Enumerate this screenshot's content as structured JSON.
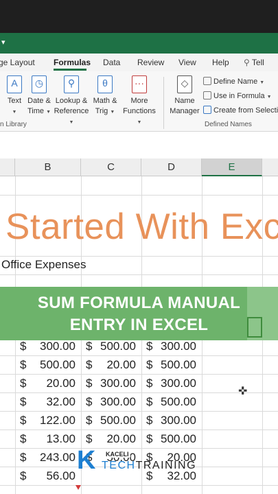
{
  "ribbon_tabs": [
    "ge Layout",
    "Formulas",
    "Data",
    "Review",
    "View",
    "Help",
    "Tell"
  ],
  "active_tab": "Formulas",
  "ribbon_buttons": {
    "text": [
      "Text"
    ],
    "datetime": [
      "Date &",
      "Time"
    ],
    "lookup": [
      "Lookup &",
      "Reference"
    ],
    "mathtrig": [
      "Math &",
      "Trig"
    ],
    "more": [
      "More",
      "Functions"
    ],
    "name_manager": [
      "Name",
      "Manager"
    ]
  },
  "groups": {
    "function_library": "n Library",
    "defined_names": "Defined Names"
  },
  "defined_names_items": [
    "Define Name",
    "Use in Formula",
    "Create from Selection"
  ],
  "columns": [
    "B",
    "C",
    "D",
    "E"
  ],
  "selected_column": "E",
  "banner_heading": "Started With Exc",
  "subheading": "Office Expenses",
  "overlay_lines": [
    "SUM FORMULA MANUAL",
    "ENTRY IN EXCEL"
  ],
  "currency_symbol": "$",
  "rows": [
    [
      "300.00",
      "500.00",
      "300.00"
    ],
    [
      "500.00",
      "20.00",
      "500.00"
    ],
    [
      "20.00",
      "300.00",
      "300.00"
    ],
    [
      "32.00",
      "300.00",
      "500.00"
    ],
    [
      "122.00",
      "500.00",
      "300.00"
    ],
    [
      "13.00",
      "20.00",
      "500.00"
    ],
    [
      "243.00",
      "50.00",
      "20.00"
    ],
    [
      "56.00",
      "",
      "32.00"
    ]
  ],
  "logo": {
    "small": "KACELI",
    "tech": "TECH",
    "training": "TRAINING"
  },
  "colors": {
    "excel_green": "#1e7145",
    "banner_orange": "#e8925a",
    "overlay_green": "#6db36b",
    "logo_blue": "#1d7fd1"
  }
}
